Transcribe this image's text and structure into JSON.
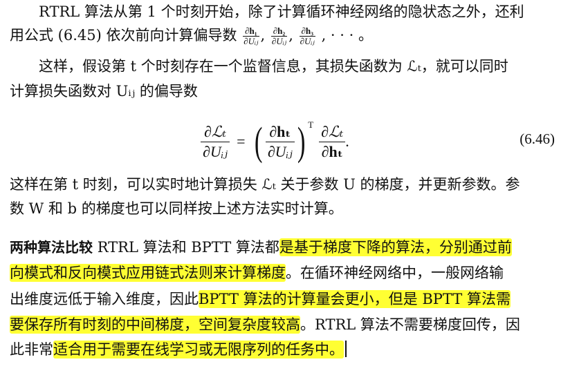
{
  "paragraph1": {
    "line1": "RTRL 算法从第 1 个时刻开始，除了计算循环神经网络的隐状态之外，还利",
    "line2_prefix": "用公式 (6.45) 依次前向计算偏导数",
    "frac1_num": "∂h₁",
    "frac1_den": "∂Uᵢⱼ",
    "frac2_num": "∂h₂",
    "frac2_den": "∂Uᵢⱼ",
    "frac3_num": "∂h₃",
    "frac3_den": "∂Uᵢⱼ",
    "line2_suffix": ", · · · 。"
  },
  "paragraph2": {
    "line1": "这样，假设第 t 个时刻存在一个监督信息，其损失函数为 ℒₜ，就可以同时",
    "line2": "计算损失函数对 Uᵢⱼ 的偏导数"
  },
  "equation": {
    "lhs_num": "∂ℒₜ",
    "lhs_den": "∂Uᵢⱼ",
    "equals": "=",
    "mid_num": "∂hₜ",
    "mid_den": "∂Uᵢⱼ",
    "transpose": "T",
    "rhs_num": "∂ℒₜ",
    "rhs_den": "∂hₜ",
    "period": ".",
    "number": "(6.46)"
  },
  "paragraph3": {
    "line1": "这样在第 t 时刻，可以实时地计算损失 ℒₜ 关于参数 U 的梯度，并更新参数。参",
    "line2": "数 W 和 b 的梯度也可以同样按上述方法实时计算。"
  },
  "paragraph4": {
    "title": "两种算法比较",
    "l1_plain": " RTRL 算法和 BPTT 算法都",
    "l1_hl": "是基于梯度下降的算法，分别通过前",
    "l2_hl": "向模式和反向模式应用链式法则来计算梯度",
    "l2_plain": "。在循环神经网络中，一般网络输",
    "l3_plain": "出维度远低于输入维度，因此",
    "l3_hl": "BPTT 算法的计算量会更小，但是 BPTT 算法需",
    "l4_hl": "要保存所有时刻的中间梯度，空间复杂度较高",
    "l4_plain": "。RTRL 算法不需要梯度回传，因",
    "l5_plain": "此非常",
    "l5_hl": "适合用于需要在线学习或无限序列的任务中。"
  },
  "colors": {
    "highlight": "#ffff33",
    "text": "#111111"
  }
}
